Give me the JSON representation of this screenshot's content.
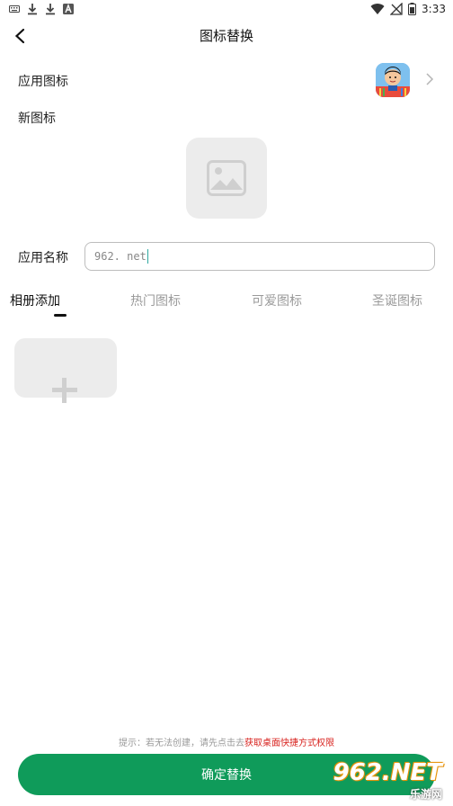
{
  "status_bar": {
    "left_icons": [
      "keyboard-icon",
      "download-icon",
      "download-icon",
      "a-icon"
    ],
    "time": "3:33"
  },
  "header": {
    "title": "图标替换"
  },
  "app_icon_row": {
    "label": "应用图标"
  },
  "new_icon_row": {
    "label": "新图标"
  },
  "app_name_row": {
    "label": "应用名称",
    "value": "962. net"
  },
  "tabs": [
    {
      "label": "相册添加",
      "active": true
    },
    {
      "label": "热门图标",
      "active": false
    },
    {
      "label": "可爱图标",
      "active": false
    },
    {
      "label": "圣诞图标",
      "active": false
    }
  ],
  "hint": {
    "prefix": "提示：若无法创建，请先点击去",
    "link": "获取桌面快捷方式权限"
  },
  "confirm_button": {
    "label": "确定替换"
  },
  "watermark": {
    "main": "962.NET",
    "sub": "乐游网"
  },
  "colors": {
    "primary": "#0f9b5a",
    "hint_link": "#d8231f"
  }
}
